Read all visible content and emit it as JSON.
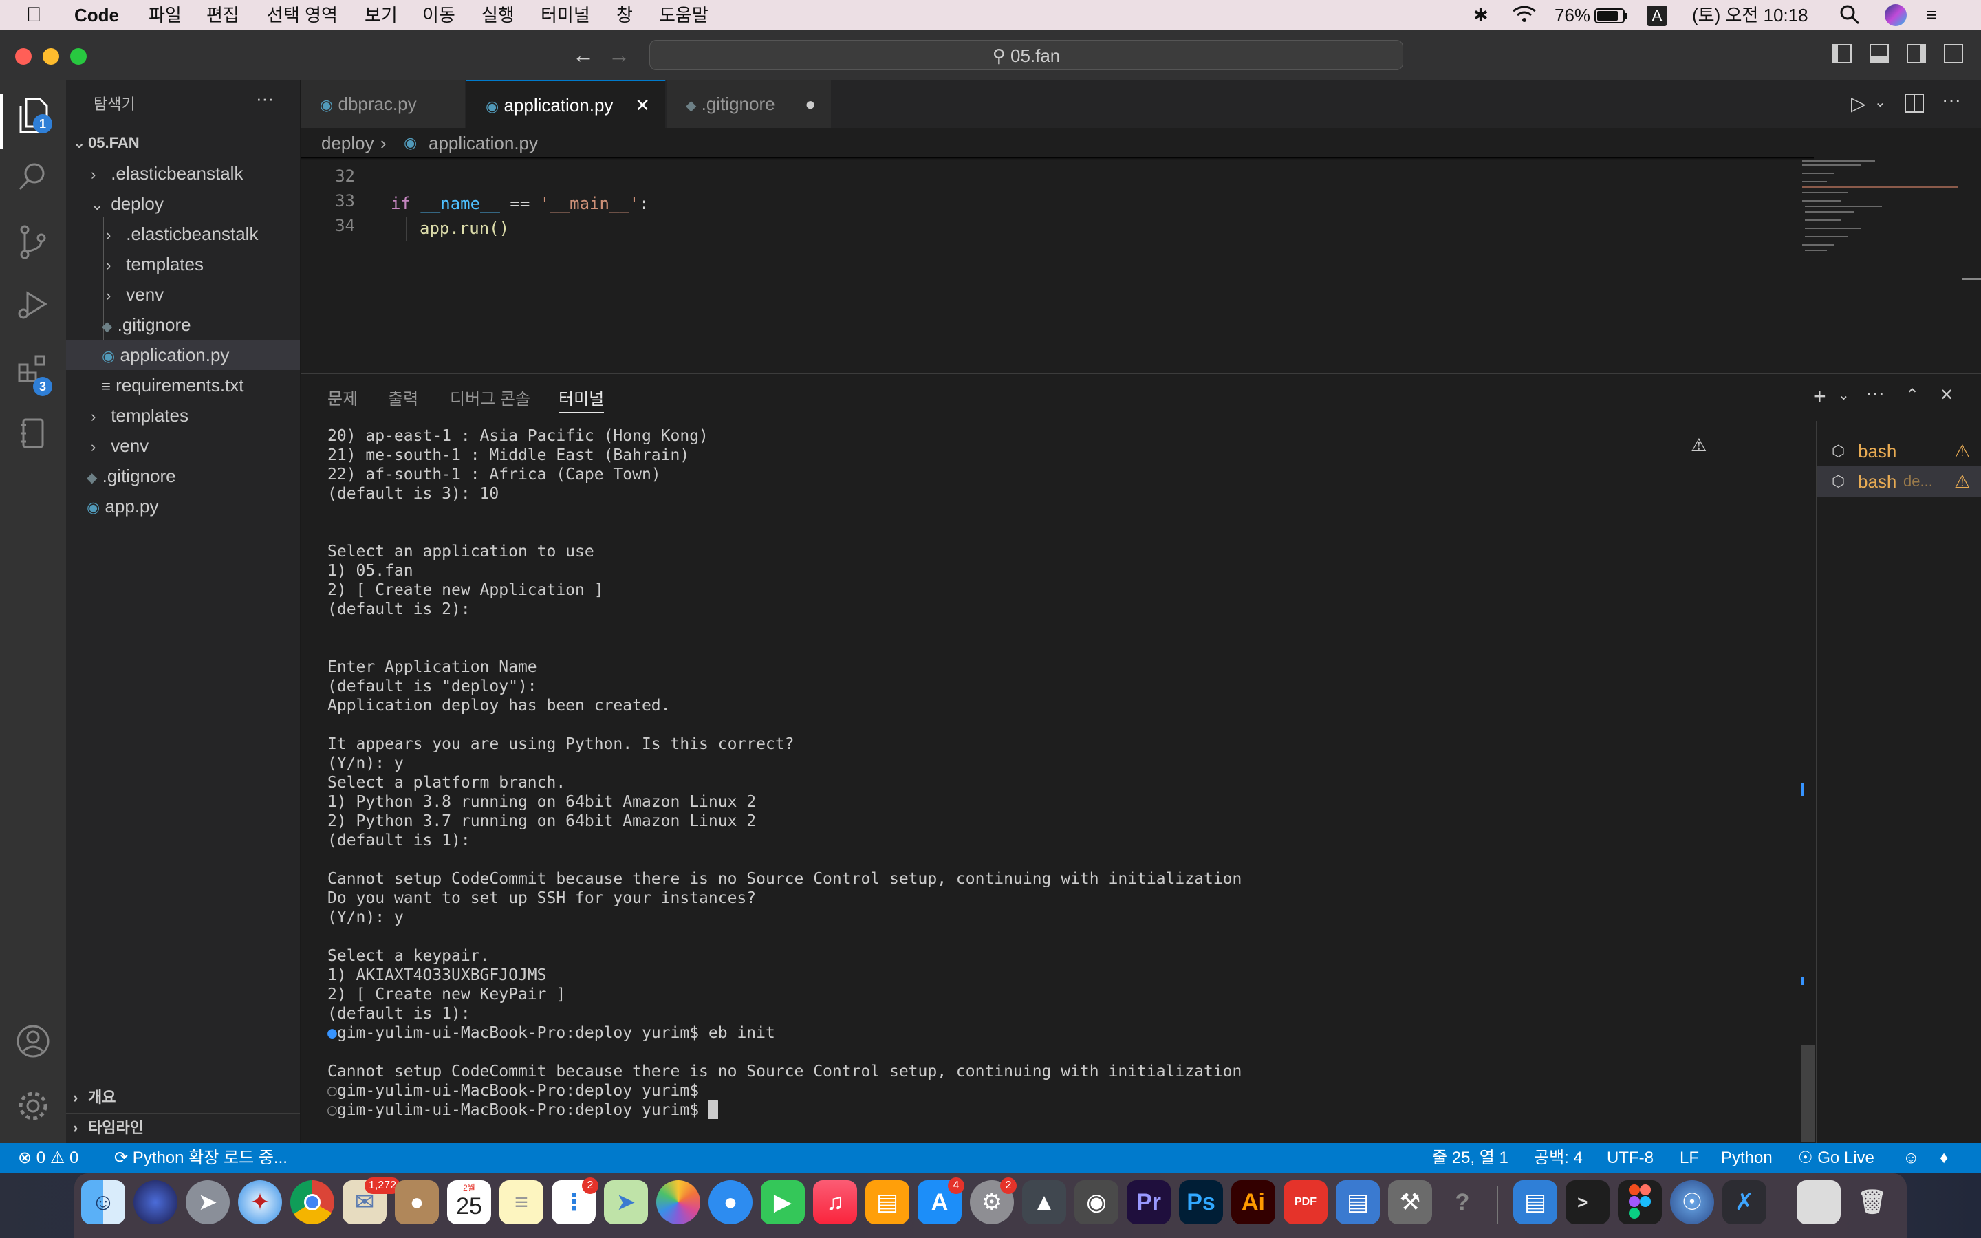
{
  "menubar": {
    "app_name": "Code",
    "items": [
      "파일",
      "편집",
      "선택 영역",
      "보기",
      "이동",
      "실행",
      "터미널",
      "창",
      "도움말"
    ],
    "battery": "76%",
    "input_source": "A",
    "clock": "(토) 오전 10:18"
  },
  "titlebar": {
    "search_text": "05.fan"
  },
  "activity": {
    "explorer_badge": "1",
    "extensions_badge": "3"
  },
  "sidebar": {
    "title": "탐색기",
    "more": "···",
    "root": "05.FAN",
    "tree": [
      {
        "label": ".elasticbeanstalk",
        "kind": "folder"
      },
      {
        "label": "deploy",
        "kind": "folder-open"
      },
      {
        "label": ".elasticbeanstalk",
        "kind": "folder"
      },
      {
        "label": "templates",
        "kind": "folder"
      },
      {
        "label": "venv",
        "kind": "folder"
      },
      {
        "label": ".gitignore",
        "kind": "git"
      },
      {
        "label": "application.py",
        "kind": "python"
      },
      {
        "label": "requirements.txt",
        "kind": "text"
      },
      {
        "label": "templates",
        "kind": "folder"
      },
      {
        "label": "venv",
        "kind": "folder"
      },
      {
        "label": ".gitignore",
        "kind": "git"
      },
      {
        "label": "app.py",
        "kind": "python"
      }
    ],
    "outline": "개요",
    "timeline": "타임라인"
  },
  "tabs": [
    {
      "label": "dbprac.py"
    },
    {
      "label": "application.py"
    },
    {
      "label": ".gitignore"
    }
  ],
  "breadcrumb": {
    "folder": "deploy",
    "sep": "›",
    "file": "application.py"
  },
  "code": {
    "lines": [
      "32",
      "33",
      "34"
    ],
    "line33_kw": "if",
    "line33_name": "__name__",
    "line33_op": "==",
    "line33_str": "'__main__'",
    "line33_colon": ":",
    "line34": "app.run()"
  },
  "panel": {
    "tabs": [
      "문제",
      "출력",
      "디버그 콘솔",
      "터미널"
    ],
    "terminal_text": "20) ap-east-1 : Asia Pacific (Hong Kong)\n21) me-south-1 : Middle East (Bahrain)\n22) af-south-1 : Africa (Cape Town)\n(default is 3): 10\n\n\nSelect an application to use\n1) 05.fan\n2) [ Create new Application ]\n(default is 2):\n\n\nEnter Application Name\n(default is \"deploy\"):\nApplication deploy has been created.\n\nIt appears you are using Python. Is this correct?\n(Y/n): y\nSelect a platform branch.\n1) Python 3.8 running on 64bit Amazon Linux 2\n2) Python 3.7 running on 64bit Amazon Linux 2\n(default is 1):\n\nCannot setup CodeCommit because there is no Source Control setup, continuing with initialization\nDo you want to set up SSH for your instances?\n(Y/n): y\n\nSelect a keypair.\n1) AKIAXT4O33UXBGFJOJMS\n2) [ Create new KeyPair ]\n(default is 1):\n",
    "prompt1": "gim-yulim-ui-MacBook-Pro:deploy yurim$ eb init",
    "after_prompt": "Cannot setup CodeCommit because there is no Source Control setup, continuing with initialization",
    "prompt2": "gim-yulim-ui-MacBook-Pro:deploy yurim$",
    "prompt3": "gim-yulim-ui-MacBook-Pro:deploy yurim$",
    "terminals": [
      {
        "label": "bash"
      },
      {
        "label": "bash",
        "extra": "de..."
      }
    ]
  },
  "statusbar": {
    "errors": "0",
    "warnings": "0",
    "loading": "Python 확장 로드 중...",
    "position": "줄 25, 열 1",
    "spaces": "공백: 4",
    "encoding": "UTF-8",
    "eol": "LF",
    "language": "Python",
    "golive": "Go Live"
  },
  "dock": {
    "mail_badge": "1,272",
    "calendar_month": "2월",
    "calendar_day": "25",
    "reminders_badge": "2",
    "appstore_badge": "4",
    "settings_badge": "2",
    "pr_label": "Pr",
    "ps_label": "Ps",
    "ai_label": "Ai",
    "pdf_label": "PDF"
  },
  "colors": {
    "accent": "#007acc",
    "terminal_warning": "#e8ab53",
    "keyword": "#c586c0",
    "string": "#ce9178"
  }
}
